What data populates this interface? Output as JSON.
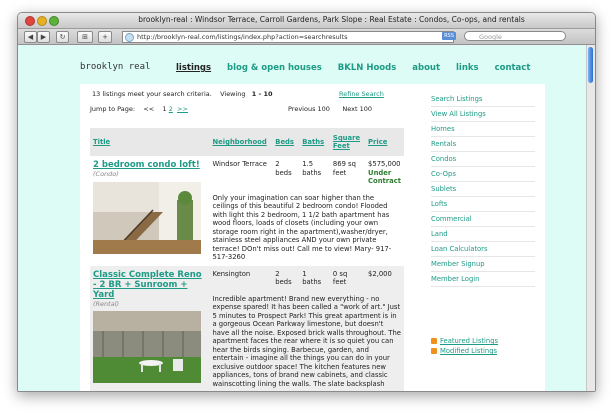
{
  "window": {
    "title": "brooklyn-real : Windsor Terrace, Carroll Gardens, Park Slope : Real Estate : Condos, Co-ops, and rentals",
    "url": "http://brooklyn-real.com/listings/index.php?action=searchresults",
    "rss_label": "RSS",
    "search_placeholder": "Google"
  },
  "site": {
    "logo": "brooklyn real",
    "nav": [
      "listings",
      "blog & open houses",
      "BKLN Hoods",
      "about",
      "links",
      "contact"
    ]
  },
  "results": {
    "summary": "13 listings meet your search criteria.",
    "viewing_label": "Viewing",
    "viewing_range": "1 - 10",
    "refine": "Refine Search",
    "jump_label": "Jump to Page:",
    "jump_prev": "<<",
    "page_current": "1",
    "page_next": "2",
    "jump_next": ">>",
    "prev_100": "Previous 100",
    "next_100": "Next 100"
  },
  "table": {
    "headers": [
      "Title",
      "Neighborhood",
      "Beds",
      "Baths",
      "Square Feet",
      "Price"
    ],
    "rows": [
      {
        "title": "2 bedroom condo loft!",
        "type": "(Condo)",
        "neighborhood": "Windsor Terrace",
        "beds": "2 beds",
        "baths": "1.5 baths",
        "sqft": "869 sq feet",
        "price": "$575,000",
        "status": "Under Contract",
        "description": "Only your imagination can soar higher than the ceilings of this beautiful 2 bedroom condo! Flooded with light this 2 bedroom, 1 1/2 bath apartment has wood floors, loads of closets (including your own storage room right in the apartment),washer/dryer, stainless steel appliances AND your own private terrace! DOn't miss out! Call me to view! Mary- 917-517-3260"
      },
      {
        "title": "Classic Complete Reno - 2 BR + Sunroom + Yard",
        "type": "(Rental)",
        "neighborhood": "Kensington",
        "beds": "2 beds",
        "baths": "1 baths",
        "sqft": "0 sq feet",
        "price": "$2,000",
        "status": "",
        "description": "Incredible apartment! Brand new everything - no expense spared! It has been called a \"work of art.\" Just 5 minutes to Prospect Park! This great apartment is in a gorgeous Ocean Parkway limestone, but doesn't have all the noise. Exposed brick walls throughout. The apartment faces the rear where it is so quiet you can hear the birds singing. Barbecue, garden, and entertain - imagine all the things you can do in your exclusive outdoor space! The kitchen features new appliances, tons of brand new cabinets, and classic wainscotting lining the walls. The slate backsplash"
      }
    ]
  },
  "sidebar": {
    "items": [
      "Search Listings",
      "View All Listings",
      "Homes",
      "Rentals",
      "Condos",
      "Co-Ops",
      "Sublets",
      "Lofts",
      "Commercial",
      "Land",
      "Loan Calculators",
      "Member Signup",
      "Member Login"
    ],
    "feeds": [
      "Featured Listings",
      "Modified Listings"
    ]
  }
}
